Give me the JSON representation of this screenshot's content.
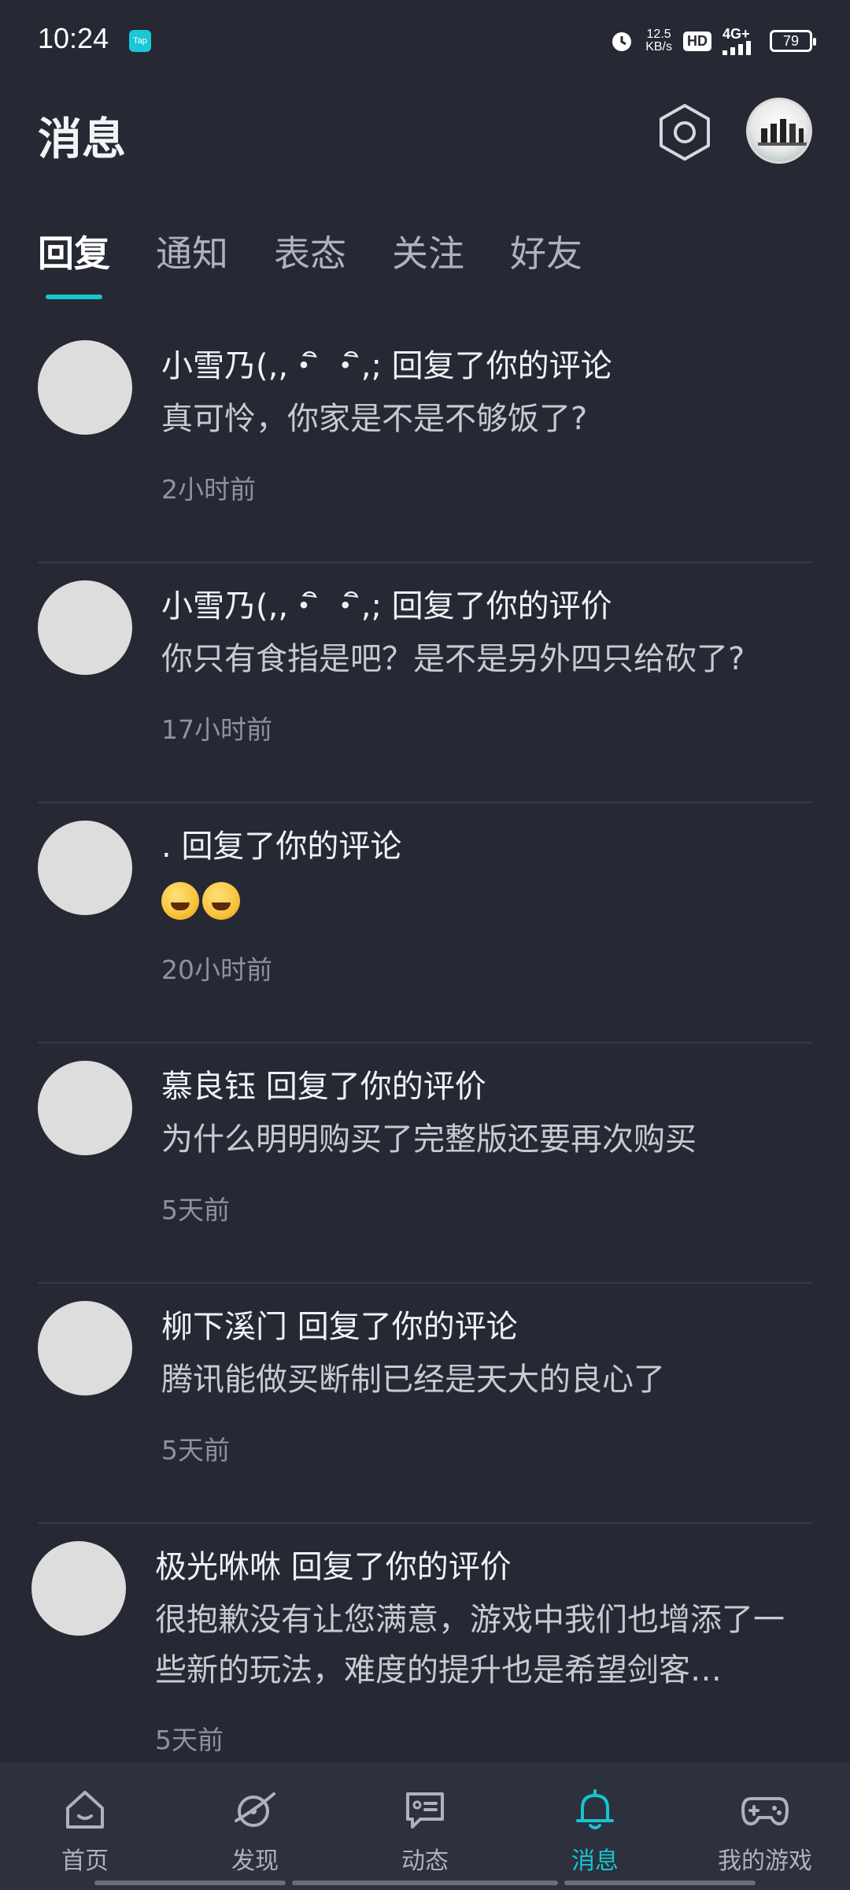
{
  "status_bar": {
    "time": "10:24",
    "app_badge": "Tap",
    "net_speed_value": "12.5",
    "net_speed_unit": "KB/s",
    "hd": "HD",
    "signal": "4G+",
    "battery": "79"
  },
  "header": {
    "title": "消息"
  },
  "tabs": [
    {
      "label": "回复",
      "active": true
    },
    {
      "label": "通知",
      "active": false
    },
    {
      "label": "表态",
      "active": false
    },
    {
      "label": "关注",
      "active": false
    },
    {
      "label": "好友",
      "active": false
    }
  ],
  "messages": [
    {
      "user": "小雪乃(,,・ิ ・ิ,;",
      "action": "回复了你的评论",
      "text": "真可怜，你家是不是不够饭了?",
      "time": "2小时前"
    },
    {
      "user": "小雪乃(,,・ิ ・ิ,;",
      "action": "回复了你的评价",
      "text": "你只有食指是吧？是不是另外四只给砍了?",
      "time": "17小时前"
    },
    {
      "user": ".",
      "action": "回复了你的评论",
      "text": "😅😅",
      "time": "20小时前"
    },
    {
      "user": "慕良钰",
      "action": "回复了你的评价",
      "text": "为什么明明购买了完整版还要再次购买",
      "time": "5天前"
    },
    {
      "user": "柳下溪门",
      "action": "回复了你的评论",
      "text": "腾讯能做买断制已经是天大的良心了",
      "time": "5天前"
    },
    {
      "user": "极光咻咻",
      "action": "回复了你的评价",
      "text": "很抱歉没有让您满意，游戏中我们也增添了一些新的玩法，难度的提升也是希望剑客…",
      "time": "5天前"
    }
  ],
  "bottom_nav": [
    {
      "label": "首页",
      "icon": "home-icon"
    },
    {
      "label": "发现",
      "icon": "discover-icon"
    },
    {
      "label": "动态",
      "icon": "feed-icon"
    },
    {
      "label": "消息",
      "icon": "bell-icon",
      "active": true
    },
    {
      "label": "我的游戏",
      "icon": "gamepad-icon"
    }
  ],
  "colors": {
    "background": "#262833",
    "accent": "#15C5CE",
    "nav_bg": "#2D303D"
  }
}
